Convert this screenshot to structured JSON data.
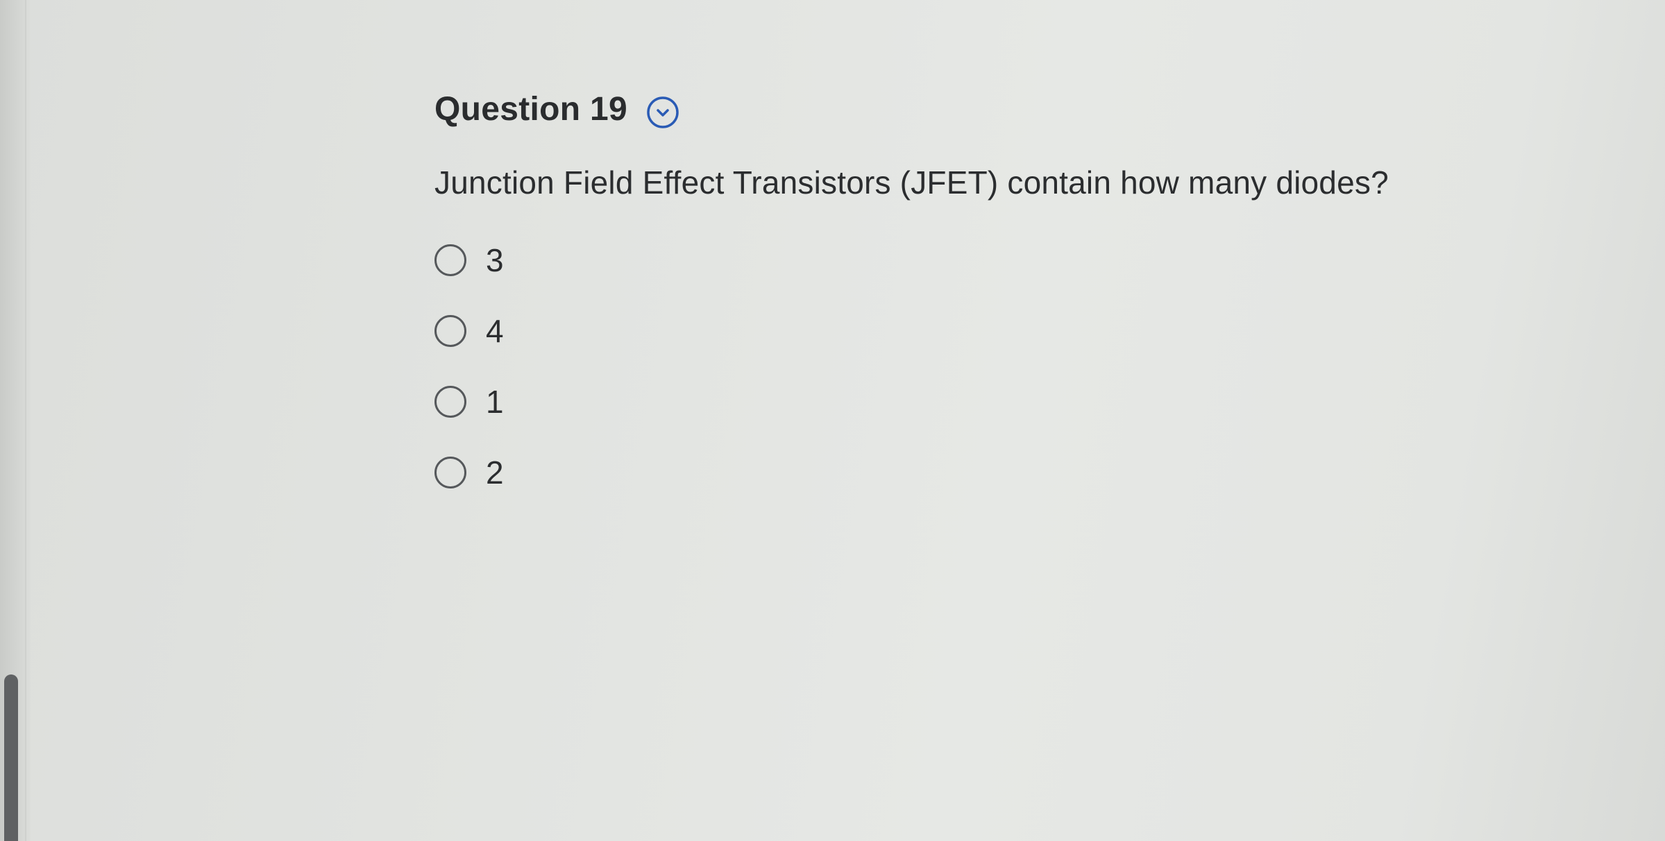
{
  "question": {
    "title": "Question 19",
    "text": "Junction Field Effect Transistors (JFET) contain how many diodes?",
    "expand_icon": "chevron-down-circle-icon",
    "accent_color": "#2a5bb5"
  },
  "options": [
    {
      "label": "3",
      "selected": false
    },
    {
      "label": "4",
      "selected": false
    },
    {
      "label": "1",
      "selected": false
    },
    {
      "label": "2",
      "selected": false
    }
  ]
}
